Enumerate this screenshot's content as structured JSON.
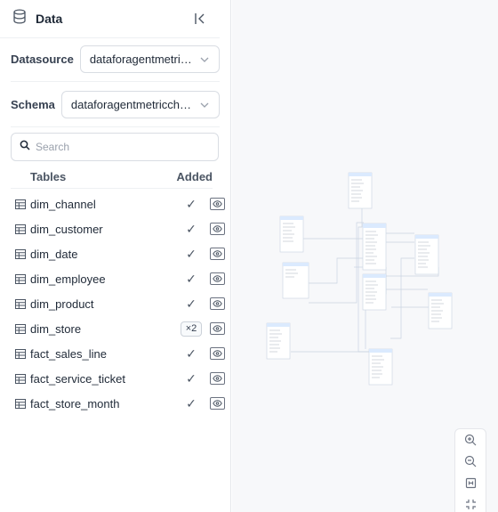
{
  "panel": {
    "title": "Data",
    "icons": {
      "panel_icon": "database-icon",
      "collapse_icon": "collapse-left-icon"
    }
  },
  "datasource": {
    "label": "Datasource",
    "value": "dataforagentmetric..."
  },
  "schema": {
    "label": "Schema",
    "value": "dataforagentmetriccha..."
  },
  "search": {
    "placeholder": "Search",
    "value": ""
  },
  "table_list": {
    "col_tables": "Tables",
    "col_added": "Added",
    "items": [
      {
        "name": "dim_channel",
        "added": "✓"
      },
      {
        "name": "dim_customer",
        "added": "✓"
      },
      {
        "name": "dim_date",
        "added": "✓"
      },
      {
        "name": "dim_employee",
        "added": "✓"
      },
      {
        "name": "dim_product",
        "added": "✓"
      },
      {
        "name": "dim_store",
        "added": "×2"
      },
      {
        "name": "fact_sales_line",
        "added": "✓"
      },
      {
        "name": "fact_service_ticket",
        "added": "✓"
      },
      {
        "name": "fact_store_month",
        "added": "✓"
      }
    ]
  },
  "zoom_controls": {
    "items": [
      "zoom-in-icon",
      "zoom-out-icon",
      "fit-view-icon",
      "fullscreen-icon"
    ]
  },
  "colors": {
    "accent": "#3b82f6",
    "border": "#d9dde3",
    "canvas_bg": "#f7f8fa",
    "node_header": "#dbeafe"
  }
}
